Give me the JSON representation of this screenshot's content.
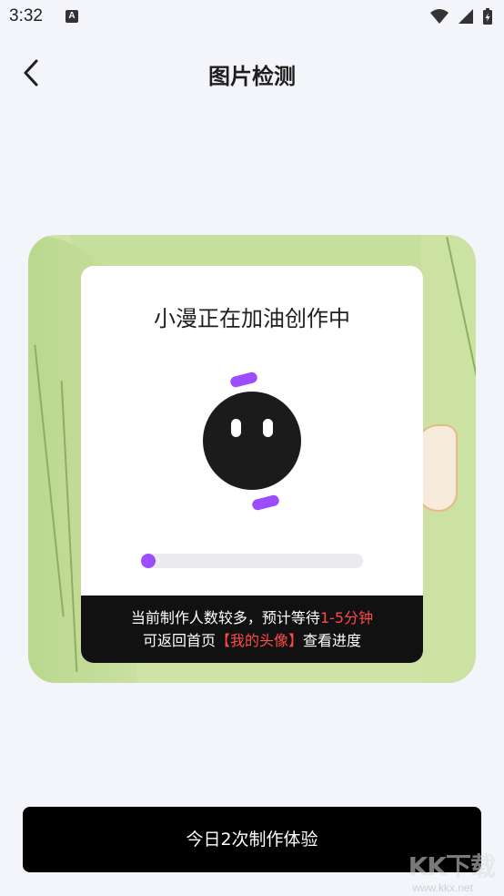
{
  "status_bar": {
    "time": "3:32",
    "notification_badge": "A",
    "icons": [
      "wifi-icon",
      "signal-icon",
      "battery-charging-icon"
    ]
  },
  "header": {
    "title": "图片检测",
    "back_icon": "chevron-left-icon"
  },
  "progress_card": {
    "title": "小漫正在加油创作中",
    "progress_fraction": 0.04,
    "accent_color": "#9b4dff",
    "notice_line1_prefix": "当前制作人数较多，预计等待",
    "notice_line1_highlight": "1-5分钟",
    "notice_line2_prefix": "可返回首页",
    "notice_line2_highlight": "【我的头像】",
    "notice_line2_suffix": "查看进度",
    "highlight_color": "#ff4a4a"
  },
  "cta": {
    "label": "今日2次制作体验"
  },
  "watermark": {
    "logo_text": "KK下载",
    "url": "www.kkx.net"
  }
}
